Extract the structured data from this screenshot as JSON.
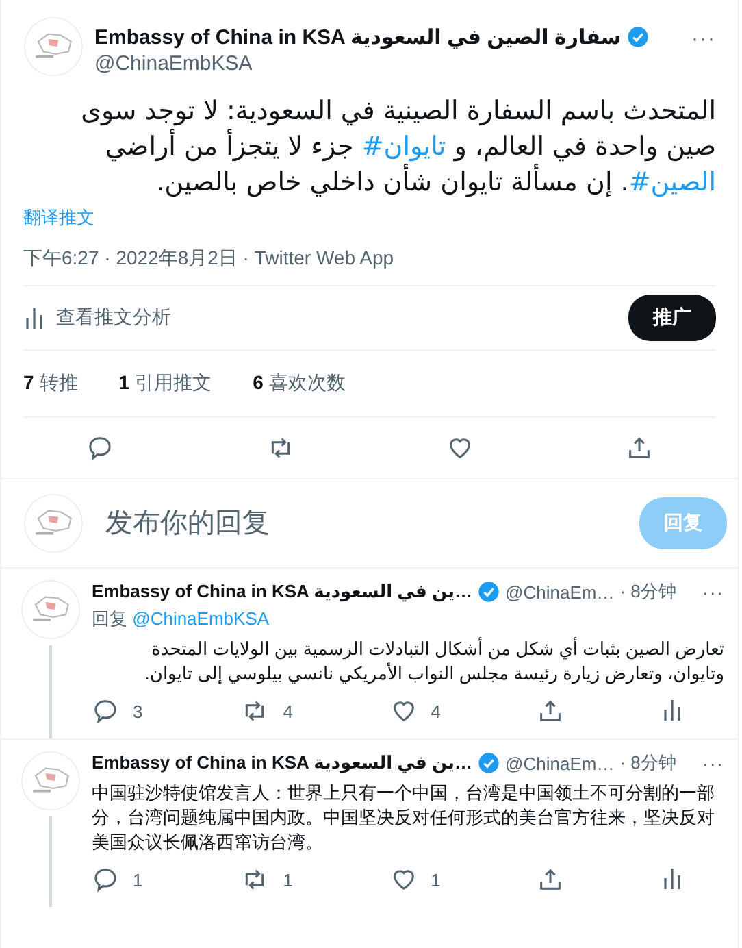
{
  "tweet": {
    "display_name": "Embassy of China in KSA سفارة الصين في السعودية",
    "verified": true,
    "handle": "@ChinaEmbKSA",
    "more": "···",
    "text": [
      {
        "kind": "text",
        "text": "المتحدث باسم السفارة الصينية في السعودية: لا توجد سوى صين واحدة في العالم، و "
      },
      {
        "kind": "hashtag",
        "text": "#تايوان"
      },
      {
        "kind": "text",
        "text": " جزء لا يتجزأ من أراضي "
      },
      {
        "kind": "hashtag",
        "text": "#الصين"
      },
      {
        "kind": "text",
        "text": ". إن مسألة تايوان شأن داخلي خاص بالصين."
      }
    ],
    "translate": "翻译推文",
    "meta": "下午6:27 · 2022年8月2日 · Twitter Web App",
    "analytics": "查看推文分析",
    "promote": "推广",
    "retweet_stat": {
      "count": "7",
      "label": "转推"
    },
    "quote_stat": {
      "count": "1",
      "label": "引用推文"
    },
    "like_stat": {
      "count": "6",
      "label": "喜欢次数"
    }
  },
  "composer": {
    "placeholder": "发布你的回复",
    "button": "回复",
    "disabled": true
  },
  "replies": [
    {
      "display_name": "Embassy of China in KSA ين في السعودية…",
      "verified": true,
      "handle": "@ChinaEm…",
      "time": "· 8分钟",
      "more": "···",
      "reply_label": "回复",
      "reply_to": "@ChinaEmbKSA",
      "text": "تعارض الصين بثبات أي شكل من أشكال التبادلات الرسمية بين الولايات المتحدة وتايوان، وتعارض زيارة رئيسة مجلس النواب الأمريكي نانسي بيلوسي إلى تايوان.",
      "replies": "3",
      "retweets": "4",
      "likes": "4"
    },
    {
      "display_name": "Embassy of China in KSA ين في السعودية…",
      "verified": true,
      "handle": "@ChinaEm…",
      "time": "· 8分钟",
      "more": "···",
      "text": "中国驻沙特使馆发言人：世界上只有一个中国，台湾是中国领土不可分割的一部分，台湾问题纯属中国内政。中国坚决反对任何形式的美台官方往来，坚决反对美国众议长佩洛西窜访台湾。",
      "replies": "1",
      "retweets": "1",
      "likes": "1"
    }
  ]
}
